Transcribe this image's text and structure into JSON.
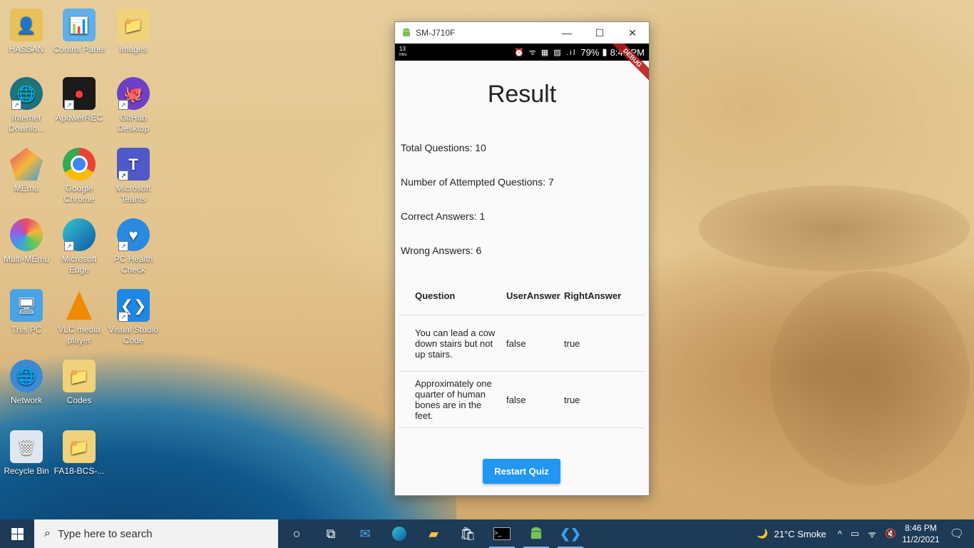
{
  "desktop_icons": [
    {
      "label": "HASSAN",
      "icon": "user-folder-icon"
    },
    {
      "label": "Control Panel",
      "icon": "control-panel-icon"
    },
    {
      "label": "images",
      "icon": "folder-icon"
    },
    {
      "label": "Internet Downlo...",
      "icon": "internet-download-manager-icon"
    },
    {
      "label": "ApowerREC",
      "icon": "apowerrec-icon"
    },
    {
      "label": "GitHub Desktop",
      "icon": "github-icon"
    },
    {
      "label": "MEmu",
      "icon": "memu-icon"
    },
    {
      "label": "Google Chrome",
      "icon": "chrome-icon"
    },
    {
      "label": "Microsoft Teams",
      "icon": "teams-icon"
    },
    {
      "label": "Multi-MEmu",
      "icon": "multi-memu-icon"
    },
    {
      "label": "Microsoft Edge",
      "icon": "edge-icon"
    },
    {
      "label": "PC Health Check",
      "icon": "health-check-icon"
    },
    {
      "label": "This PC",
      "icon": "computer-icon"
    },
    {
      "label": "VLC media player",
      "icon": "vlc-icon"
    },
    {
      "label": "Visual Studio Code",
      "icon": "vscode-icon"
    },
    {
      "label": "Network",
      "icon": "network-icon"
    },
    {
      "label": "Codes",
      "icon": "folder-icon"
    },
    {
      "label": "Recycle Bin",
      "icon": "recycle-bin-icon"
    },
    {
      "label": "FA18-BCS-...",
      "icon": "folder-icon"
    }
  ],
  "window": {
    "title": "SM-J710F",
    "status": {
      "kbps": "13",
      "kbps_unit": "KB/s",
      "battery": "79%",
      "time": "8:46 PM"
    },
    "debug_banner": "DEBUG"
  },
  "result": {
    "title": "Result",
    "total": "Total Questions: 10",
    "attempted": "Number of Attempted Questions: 7",
    "correct": "Correct Answers: 1",
    "wrong": "Wrong Answers: 6",
    "table": {
      "headers": [
        "Question",
        "UserAnswer",
        "RightAnswer"
      ],
      "rows": [
        {
          "question": "You can lead a cow down stairs but not up stairs.",
          "user": "false",
          "right": "true"
        },
        {
          "question": "Approximately one quarter of human bones are in the feet.",
          "user": "false",
          "right": "true"
        }
      ]
    },
    "restart_label": "Restart Quiz"
  },
  "taskbar": {
    "search_placeholder": "Type here to search",
    "weather": "21°C  Smoke",
    "time": "8:46 PM",
    "date": "11/2/2021"
  }
}
